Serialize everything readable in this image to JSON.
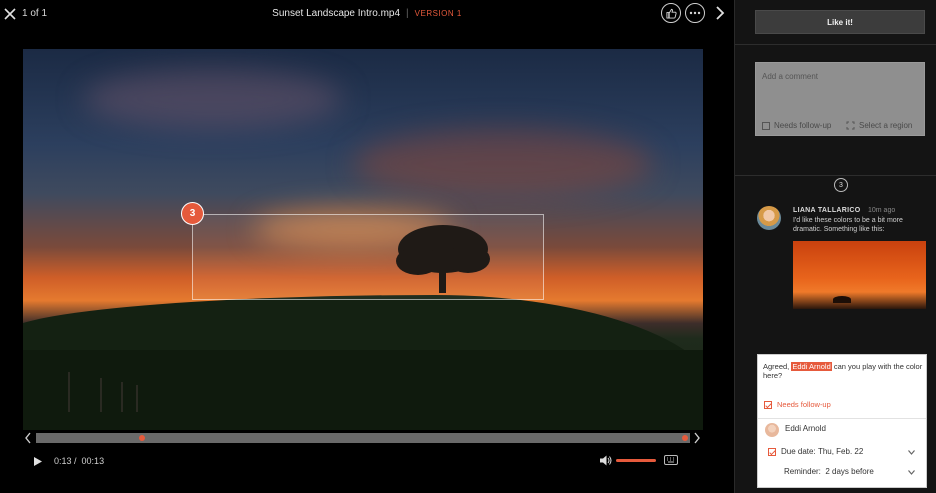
{
  "player": {
    "counter": "1 of 1",
    "title": "Sunset Landscape Intro.mp4",
    "separator": "|",
    "version": "VERSION 1",
    "region_pin": "3",
    "time_current": "0:13 /",
    "time_total": "00:13"
  },
  "panel": {
    "like_button": "Like it!",
    "comment_placeholder": "Add a comment",
    "needs_followup_option": "Needs follow-up",
    "select_region_option": "Select a region",
    "comment_count": "3",
    "comment": {
      "author": "LIANA TALLARICO",
      "ago": "10m ago",
      "text": "I'd like these colors to be a bit more dramatic. Something like this:"
    },
    "reply": {
      "prefix": "Agreed,",
      "mention": "Eddi Arnold",
      "suffix": "can you play with the color here?",
      "needs_followup": "Needs follow-up",
      "assignee": "Eddi Arnold",
      "due_label": "Due date:",
      "due_value": "Thu, Feb. 22",
      "reminder_label": "Reminder:",
      "reminder_value": "2 days before"
    }
  },
  "colors": {
    "accent": "#e65a3c",
    "panel_bg": "#141414",
    "player_bg": "#000000"
  },
  "icons": [
    "close-icon",
    "thumbs-up-icon",
    "more-icon",
    "chevron-right-icon",
    "chevron-left-icon",
    "play-icon",
    "volume-icon",
    "keyboard-icon",
    "checkbox-icon",
    "region-select-icon",
    "chevron-down-icon"
  ]
}
